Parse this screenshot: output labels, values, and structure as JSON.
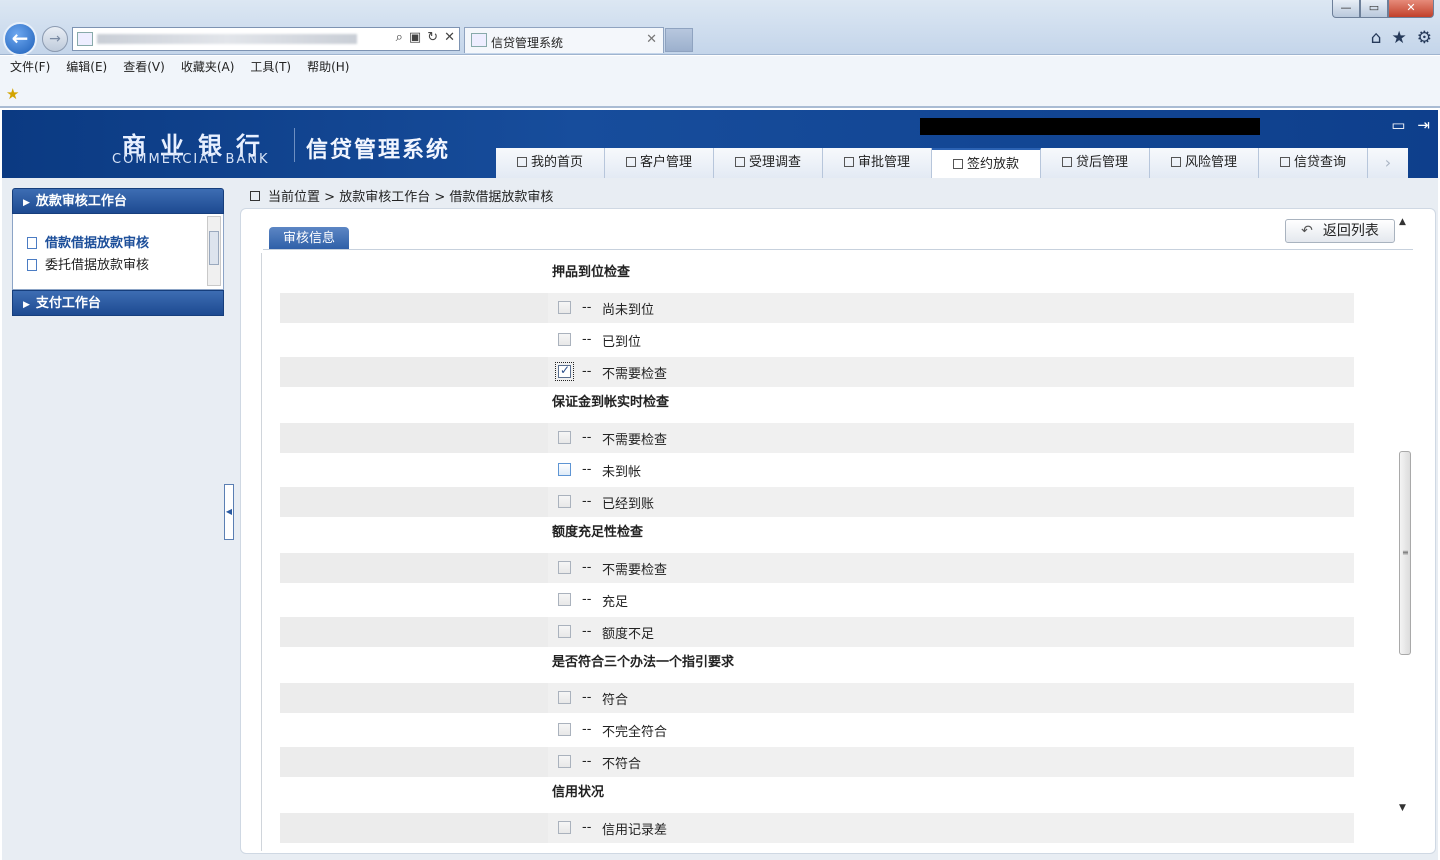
{
  "browser": {
    "tab_title": "信贷管理系统",
    "window_buttons": [
      "—",
      "▭",
      "✕"
    ],
    "menu": [
      "文件(F)",
      "编辑(E)",
      "查看(V)",
      "收藏夹(A)",
      "工具(T)",
      "帮助(H)"
    ],
    "icons": [
      "home-icon",
      "star-icon",
      "gear-icon"
    ]
  },
  "header": {
    "logo_cn": "商业银行",
    "logo_en": "COMMERCIAL BANK",
    "system_title": "信贷管理系统",
    "nav": [
      {
        "label": "我的首页",
        "active": false
      },
      {
        "label": "客户管理",
        "active": false
      },
      {
        "label": "受理调查",
        "active": false
      },
      {
        "label": "审批管理",
        "active": false
      },
      {
        "label": "签约放款",
        "active": true
      },
      {
        "label": "贷后管理",
        "active": false
      },
      {
        "label": "风险管理",
        "active": false
      },
      {
        "label": "信贷查询",
        "active": false
      }
    ]
  },
  "sidebar": {
    "panel1": "放款审核工作台",
    "items": [
      {
        "label": "借款借据放款审核",
        "active": true
      },
      {
        "label": "委托借据放款审核",
        "active": false
      }
    ],
    "panel2": "支付工作台"
  },
  "breadcrumb": {
    "prefix": "当前位置",
    "sep": ">",
    "level1": "放款审核工作台",
    "level2": "借款借据放款审核"
  },
  "main": {
    "back_button": "返回列表",
    "tab": "审核信息",
    "dash": "--",
    "sections": [
      {
        "title": "押品到位检查",
        "options": [
          {
            "label": "尚未到位",
            "checked": false
          },
          {
            "label": "已到位",
            "checked": false
          },
          {
            "label": "不需要检查",
            "checked": true
          }
        ]
      },
      {
        "title": "保证金到帐实时检查",
        "options": [
          {
            "label": "不需要检查",
            "checked": false
          },
          {
            "label": "未到帐",
            "checked": false
          },
          {
            "label": "已经到账",
            "checked": false
          }
        ]
      },
      {
        "title": "额度充足性检查",
        "options": [
          {
            "label": "不需要检查",
            "checked": false
          },
          {
            "label": "充足",
            "checked": false
          },
          {
            "label": "额度不足",
            "checked": false
          }
        ]
      },
      {
        "title": "是否符合三个办法一个指引要求",
        "options": [
          {
            "label": "符合",
            "checked": false
          },
          {
            "label": "不完全符合",
            "checked": false
          },
          {
            "label": "不符合",
            "checked": false
          }
        ]
      },
      {
        "title": "信用状况",
        "options": [
          {
            "label": "信用记录差",
            "checked": false
          }
        ]
      }
    ]
  }
}
